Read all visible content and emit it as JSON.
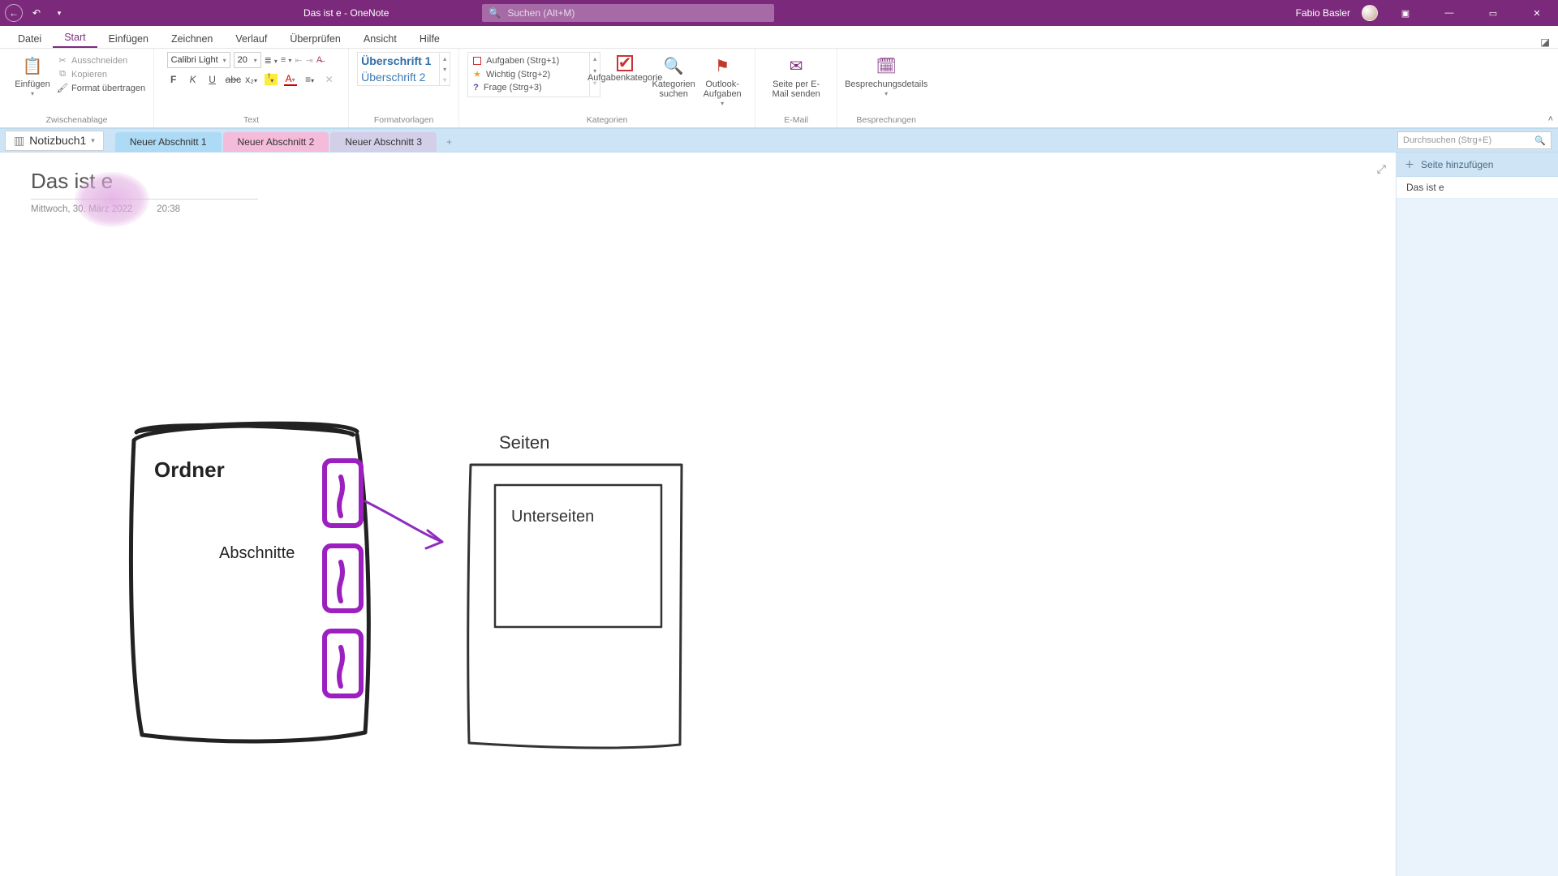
{
  "app": {
    "title": "Das ist e  -  OneNote",
    "user": "Fabio Basler",
    "search_placeholder": "Suchen (Alt+M)"
  },
  "window_controls": {
    "minimize": "—",
    "restore": "▭",
    "close": "✕",
    "ribbon_mode": "▣"
  },
  "ribbon_tabs": {
    "datei": "Datei",
    "start": "Start",
    "einfuegen": "Einfügen",
    "zeichnen": "Zeichnen",
    "verlauf": "Verlauf",
    "ueberpruefen": "Überprüfen",
    "ansicht": "Ansicht",
    "hilfe": "Hilfe"
  },
  "ribbon": {
    "clipboard": {
      "paste": "Einfügen",
      "cut": "Ausschneiden",
      "copy": "Kopieren",
      "format_painter": "Format übertragen",
      "group": "Zwischenablage"
    },
    "text": {
      "font_name": "Calibri Light",
      "font_size": "20",
      "group": "Text"
    },
    "styles": {
      "h1": "Überschrift 1",
      "h2": "Überschrift 2",
      "group": "Formatvorlagen"
    },
    "tags": {
      "t1": "Aufgaben (Strg+1)",
      "t2": "Wichtig (Strg+2)",
      "t3": "Frage (Strg+3)",
      "find_tags": "Aufgabenkategorie",
      "search_tags": "Kategorien suchen",
      "outlook_tasks": "Outlook-Aufgaben",
      "group": "Kategorien"
    },
    "email": {
      "btn": "Seite per E-Mail senden",
      "group": "E-Mail"
    },
    "meetings": {
      "btn": "Besprechungsdetails",
      "group": "Besprechungen"
    }
  },
  "notebook": {
    "name": "Notizbuch1",
    "section_tabs": [
      "Neuer Abschnitt 1",
      "Neuer Abschnitt 2",
      "Neuer Abschnitt 3"
    ],
    "add_tab": "+",
    "search_placeholder": "Durchsuchen (Strg+E)"
  },
  "pagepane": {
    "add_page": "Seite hinzufügen",
    "pages": [
      "Das ist e"
    ]
  },
  "page": {
    "title": "Das ist e",
    "date": "Mittwoch, 30. März 2022",
    "time": "20:38"
  },
  "drawing": {
    "ordner": "Ordner",
    "abschnitte": "Abschnitte",
    "seiten": "Seiten",
    "unterseiten": "Unterseiten"
  }
}
